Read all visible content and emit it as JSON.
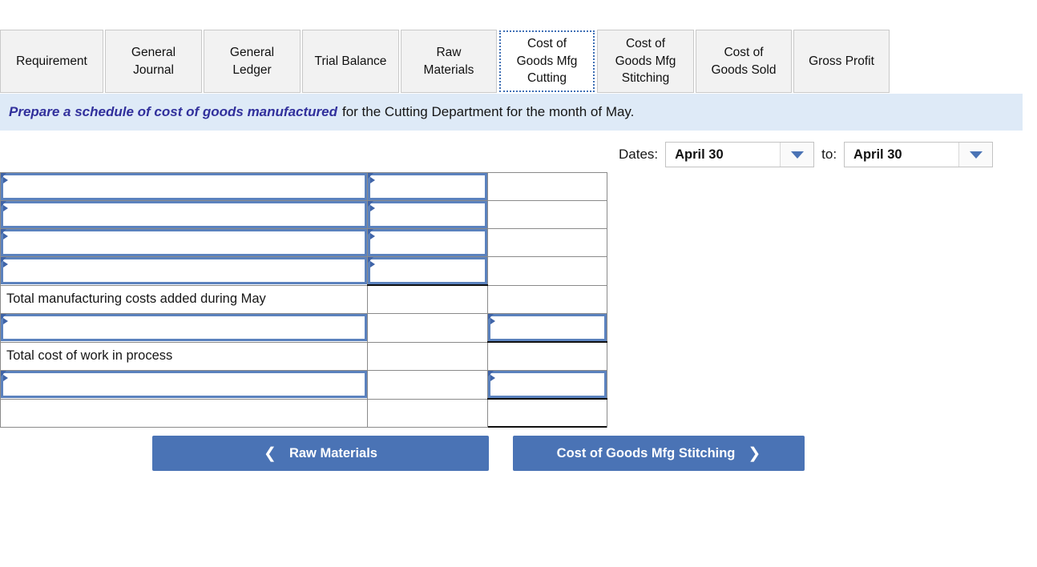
{
  "tabs": [
    {
      "label": "Requirement",
      "active": false
    },
    {
      "label": "General Journal",
      "active": false
    },
    {
      "label": "General Ledger",
      "active": false
    },
    {
      "label": "Trial Balance",
      "active": false
    },
    {
      "label": "Raw Materials",
      "active": false
    },
    {
      "label": "Cost of Goods Mfg Cutting",
      "active": true
    },
    {
      "label": "Cost of Goods Mfg Stitching",
      "active": false
    },
    {
      "label": "Cost of Goods Sold",
      "active": false
    },
    {
      "label": "Gross Profit",
      "active": false
    }
  ],
  "instruction": {
    "emphasis": "Prepare a schedule of cost of goods manufactured",
    "rest": "for the Cutting Department for the month of May."
  },
  "dates": {
    "label": "Dates:",
    "from_value": "April 30",
    "to_label": "to:",
    "to_value": "April 30",
    "arrow_icon": "chevron-down-icon"
  },
  "sheet": {
    "rows": [
      {
        "label": "",
        "label_editable": true,
        "col_b_editable": true,
        "col_c_editable": false
      },
      {
        "label": "",
        "label_editable": true,
        "col_b_editable": true,
        "col_c_editable": false
      },
      {
        "label": "",
        "label_editable": true,
        "col_b_editable": true,
        "col_c_editable": false
      },
      {
        "label": "",
        "label_editable": true,
        "col_b_editable": true,
        "col_c_editable": false
      },
      {
        "label": "Total manufacturing costs added during May",
        "label_editable": false,
        "col_b_editable": false,
        "col_c_editable": false
      },
      {
        "label": "",
        "label_editable": true,
        "col_b_editable": false,
        "col_c_editable": true
      },
      {
        "label": "Total cost of work in process",
        "label_editable": false,
        "col_b_editable": false,
        "col_c_editable": false
      },
      {
        "label": "",
        "label_editable": true,
        "col_b_editable": false,
        "col_c_editable": true
      },
      {
        "label": "",
        "label_editable": false,
        "col_b_editable": false,
        "col_c_editable": false
      }
    ]
  },
  "navigation": {
    "prev_label": "Raw Materials",
    "prev_icon": "chevron-left-icon",
    "next_label": "Cost of Goods Mfg Stitching",
    "next_icon": "chevron-right-icon"
  },
  "colors": {
    "accent_blue": "#4a73b5",
    "banner_bg": "#deeaf7",
    "emphasis_text": "#31309c",
    "cell_border": "#5b82be",
    "tab_bg": "#f2f2f2"
  }
}
